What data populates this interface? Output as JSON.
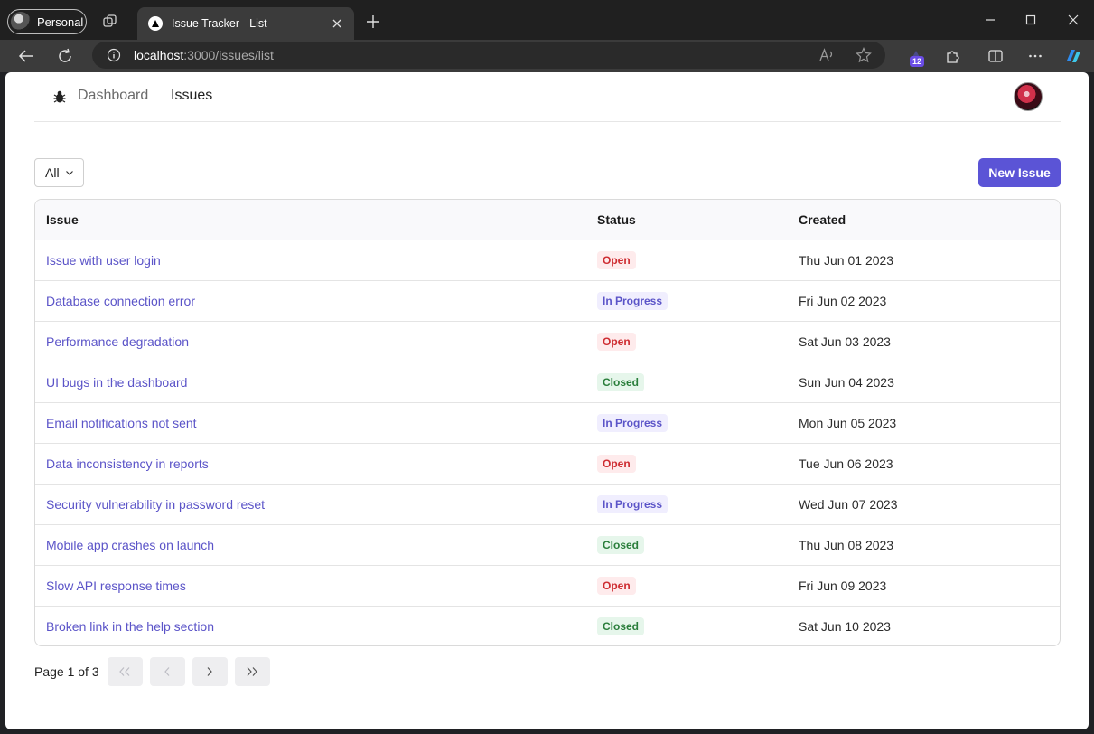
{
  "browser": {
    "profile_label": "Personal",
    "tab_title": "Issue Tracker - List",
    "url_host": "localhost",
    "url_path": ":3000/issues/list",
    "extension_badge": "12"
  },
  "nav": {
    "dashboard": "Dashboard",
    "issues": "Issues"
  },
  "toolbar": {
    "filter_value": "All",
    "new_issue": "New Issue"
  },
  "table": {
    "columns": [
      "Issue",
      "Status",
      "Created"
    ],
    "rows": [
      {
        "title": "Issue with user login",
        "status": "Open",
        "created": "Thu Jun 01 2023"
      },
      {
        "title": "Database connection error",
        "status": "In Progress",
        "created": "Fri Jun 02 2023"
      },
      {
        "title": "Performance degradation",
        "status": "Open",
        "created": "Sat Jun 03 2023"
      },
      {
        "title": "UI bugs in the dashboard",
        "status": "Closed",
        "created": "Sun Jun 04 2023"
      },
      {
        "title": "Email notifications not sent",
        "status": "In Progress",
        "created": "Mon Jun 05 2023"
      },
      {
        "title": "Data inconsistency in reports",
        "status": "Open",
        "created": "Tue Jun 06 2023"
      },
      {
        "title": "Security vulnerability in password reset",
        "status": "In Progress",
        "created": "Wed Jun 07 2023"
      },
      {
        "title": "Mobile app crashes on launch",
        "status": "Closed",
        "created": "Thu Jun 08 2023"
      },
      {
        "title": "Slow API response times",
        "status": "Open",
        "created": "Fri Jun 09 2023"
      },
      {
        "title": "Broken link in the help section",
        "status": "Closed",
        "created": "Sat Jun 10 2023"
      }
    ]
  },
  "pagination": {
    "label": "Page 1 of 3"
  },
  "colors": {
    "accent": "#5b54d6",
    "open": "#ce2c31",
    "in_progress": "#5b54c8",
    "closed": "#2a7e3b"
  }
}
